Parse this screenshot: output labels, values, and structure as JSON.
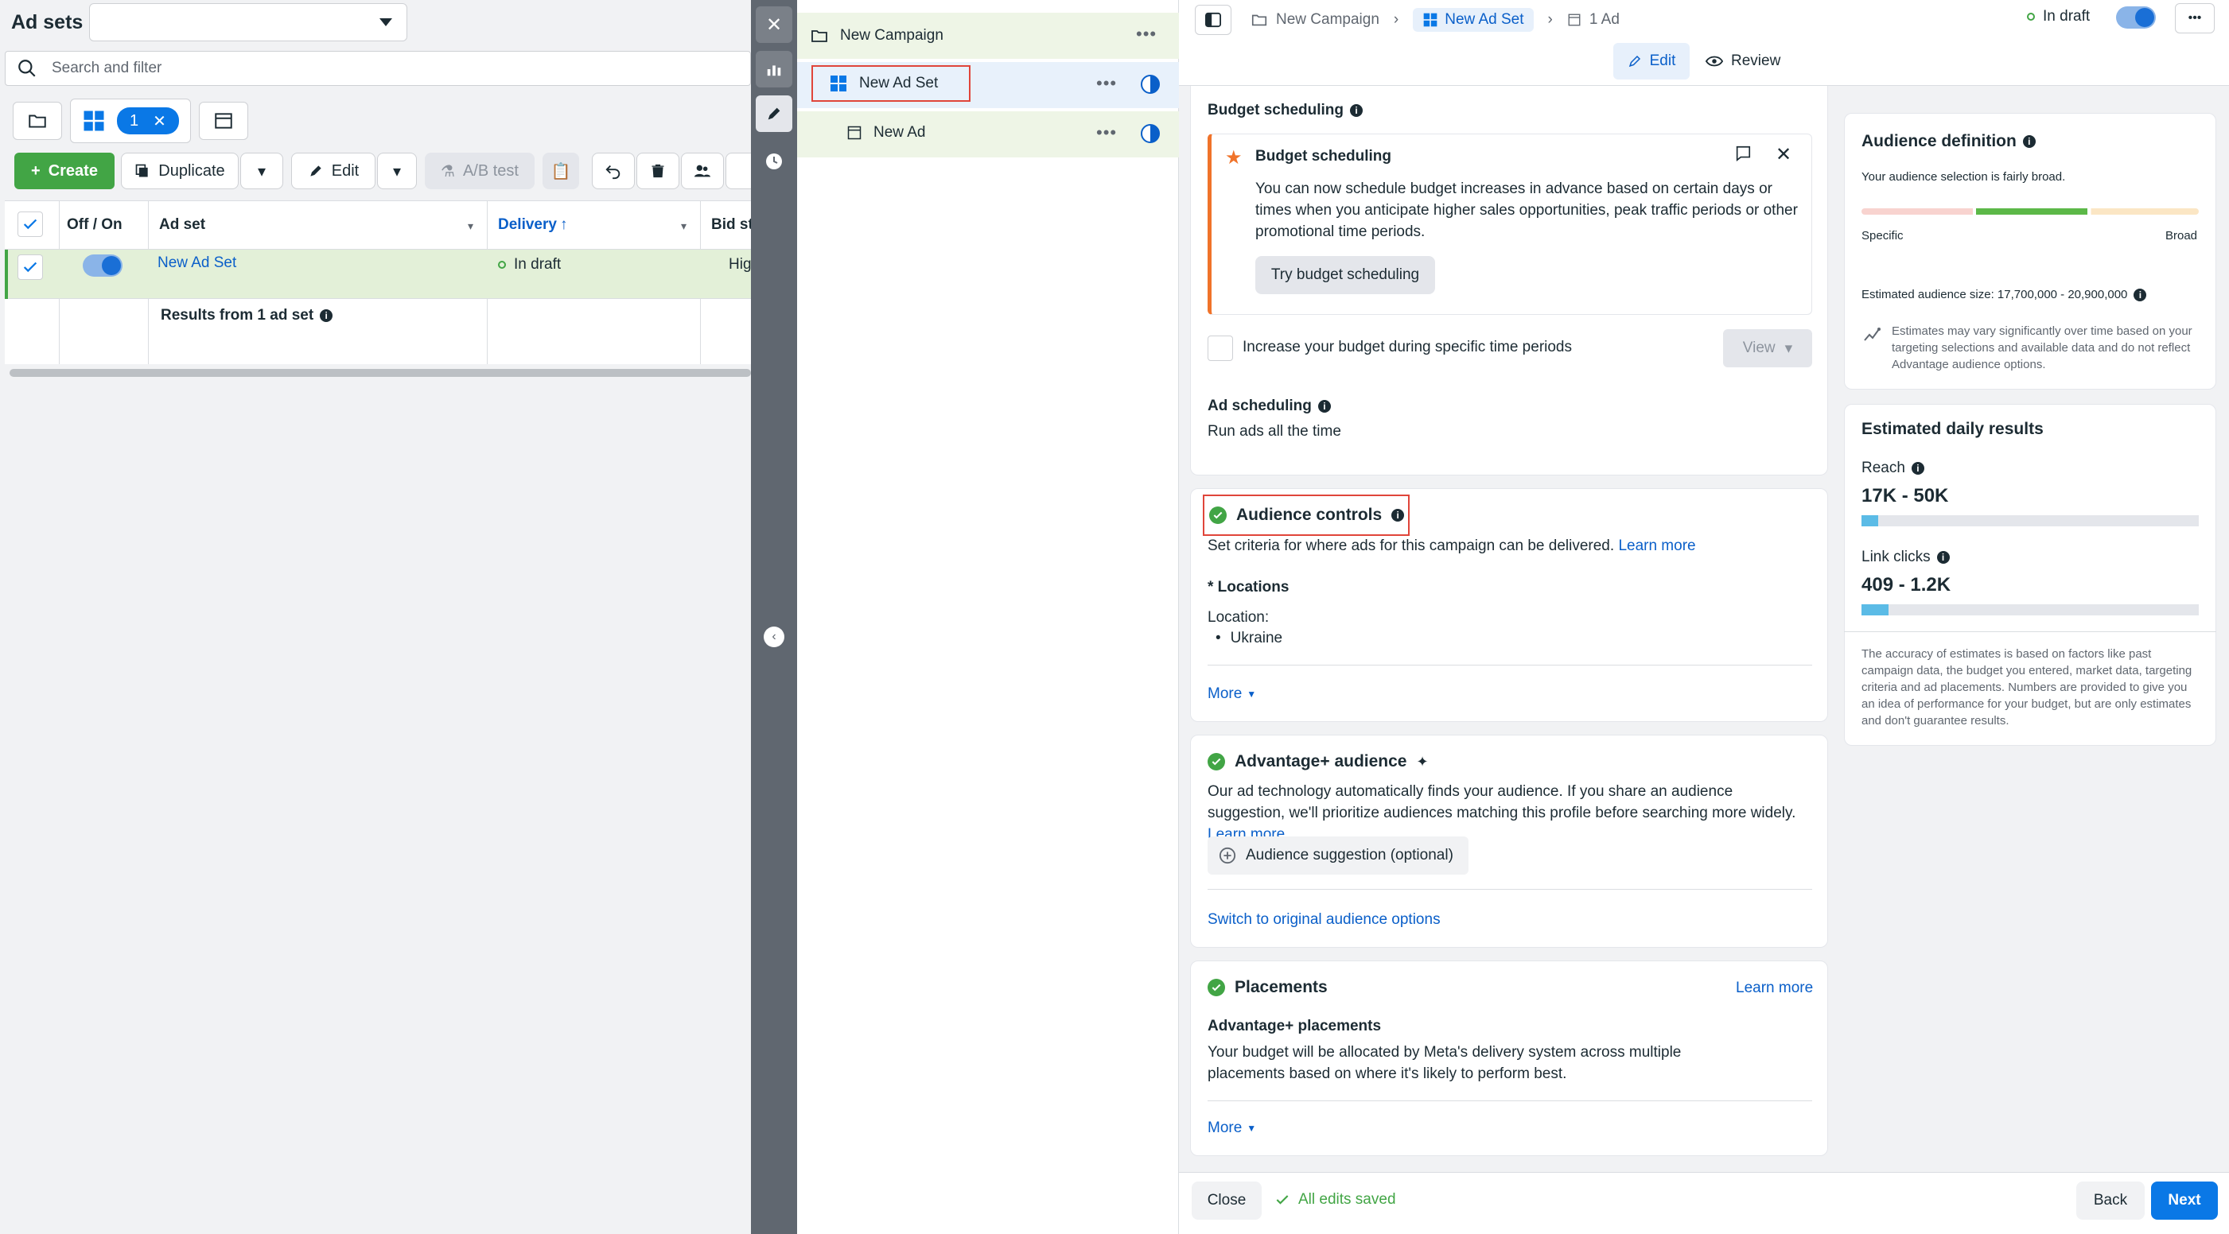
{
  "left": {
    "title": "Ad sets",
    "search_placeholder": "Search and filter",
    "filter_count": "1",
    "toolbar": {
      "create": "Create",
      "duplicate": "Duplicate",
      "edit": "Edit",
      "ab_test": "A/B test"
    },
    "table": {
      "headers": [
        "Off / On",
        "Ad set",
        "Delivery",
        "Bid st"
      ],
      "delivery_sort": "↑",
      "row": {
        "name": "New Ad Set",
        "delivery": "In draft",
        "bid": "Hig"
      },
      "results": "Results from 1 ad set"
    }
  },
  "tree": {
    "campaign": "New Campaign",
    "adset": "New Ad Set",
    "ad": "New Ad"
  },
  "header": {
    "crumb_campaign": "New Campaign",
    "crumb_adset": "New Ad Set",
    "crumb_ad": "1 Ad",
    "status": "In draft",
    "tab_edit": "Edit",
    "tab_review": "Review"
  },
  "budget": {
    "section_title": "Budget scheduling",
    "notice_title": "Budget scheduling",
    "notice_text": "You can now schedule budget increases in advance based on certain days or times when you anticipate higher sales opportunities, peak traffic periods or other promotional time periods.",
    "try_button": "Try budget scheduling",
    "increase_label": "Increase your budget during specific time periods",
    "view_button": "View",
    "ad_scheduling_title": "Ad scheduling",
    "ad_scheduling_value": "Run ads all the time"
  },
  "audience_controls": {
    "title": "Audience controls",
    "desc": "Set criteria for where ads for this campaign can be delivered.",
    "learn_more": "Learn more",
    "locations_title": "* Locations",
    "location_label": "Location:",
    "location_value": "Ukraine",
    "more": "More"
  },
  "advantage": {
    "title": "Advantage+ audience",
    "desc": "Our ad technology automatically finds your audience. If you share an audience suggestion, we'll prioritize audiences matching this profile before searching more widely.",
    "learn_more": "Learn more",
    "suggestion_button": "Audience suggestion (optional)",
    "switch_link": "Switch to original audience options"
  },
  "placements": {
    "title": "Placements",
    "learn_more": "Learn more",
    "sub_title": "Advantage+ placements",
    "desc": "Your budget will be allocated by Meta's delivery system across multiple placements based on where it's likely to perform best.",
    "more": "More"
  },
  "audience_def": {
    "title": "Audience definition",
    "subtitle": "Your audience selection is fairly broad.",
    "specific": "Specific",
    "broad": "Broad",
    "est_size": "Estimated audience size: 17,700,000 - 20,900,000",
    "note": "Estimates may vary significantly over time based on your targeting selections and available data and do not reflect Advantage audience options."
  },
  "daily": {
    "title": "Estimated daily results",
    "reach_label": "Reach",
    "reach_value": "17K - 50K",
    "reach_fill": 0.05,
    "clicks_label": "Link clicks",
    "clicks_value": "409 - 1.2K",
    "clicks_fill": 0.08,
    "disclaimer": "The accuracy of estimates is based on factors like past campaign data, the budget you entered, market data, targeting criteria and ad placements. Numbers are provided to give you an idea of performance for your budget, but are only estimates and don't guarantee results."
  },
  "footer": {
    "close": "Close",
    "saved": "All edits saved",
    "back": "Back",
    "next": "Next"
  },
  "colors": {
    "accent": "#0a78e6",
    "green": "#42a545",
    "highlight_box": "#e0453a"
  }
}
